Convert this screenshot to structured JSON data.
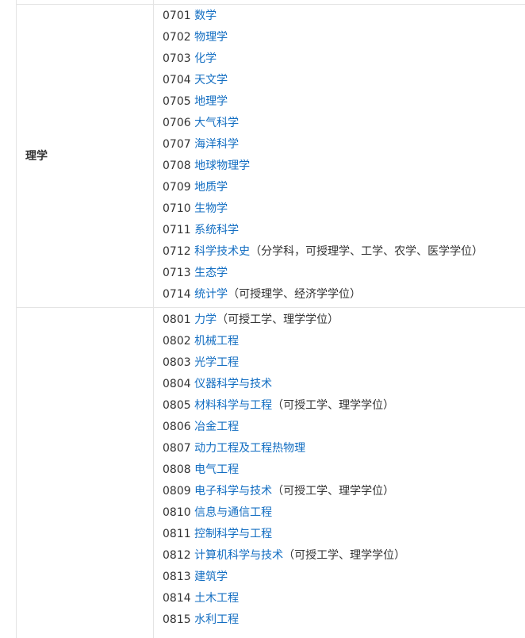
{
  "sections": [
    {
      "category": "理学",
      "items": [
        {
          "code": "0701",
          "name": "数学",
          "note": ""
        },
        {
          "code": "0702",
          "name": "物理学",
          "note": ""
        },
        {
          "code": "0703",
          "name": "化学",
          "note": ""
        },
        {
          "code": "0704",
          "name": "天文学",
          "note": ""
        },
        {
          "code": "0705",
          "name": "地理学",
          "note": ""
        },
        {
          "code": "0706",
          "name": "大气科学",
          "note": ""
        },
        {
          "code": "0707",
          "name": "海洋科学",
          "note": ""
        },
        {
          "code": "0708",
          "name": "地球物理学",
          "note": ""
        },
        {
          "code": "0709",
          "name": "地质学",
          "note": ""
        },
        {
          "code": "0710",
          "name": "生物学",
          "note": ""
        },
        {
          "code": "0711",
          "name": "系统科学",
          "note": ""
        },
        {
          "code": "0712",
          "name": "科学技术史",
          "note": "（分学科，可授理学、工学、农学、医学学位）"
        },
        {
          "code": "0713",
          "name": "生态学",
          "note": ""
        },
        {
          "code": "0714",
          "name": "统计学",
          "note": "（可授理学、经济学学位）"
        }
      ]
    },
    {
      "category": "",
      "items": [
        {
          "code": "0801",
          "name": "力学",
          "note": "（可授工学、理学学位）"
        },
        {
          "code": "0802",
          "name": "机械工程",
          "note": ""
        },
        {
          "code": "0803",
          "name": "光学工程",
          "note": ""
        },
        {
          "code": "0804",
          "name": "仪器科学与技术",
          "note": ""
        },
        {
          "code": "0805",
          "name": "材料科学与工程",
          "note": "（可授工学、理学学位）"
        },
        {
          "code": "0806",
          "name": "冶金工程",
          "note": ""
        },
        {
          "code": "0807",
          "name": "动力工程及工程热物理",
          "note": ""
        },
        {
          "code": "0808",
          "name": "电气工程",
          "note": ""
        },
        {
          "code": "0809",
          "name": "电子科学与技术",
          "note": "（可授工学、理学学位）"
        },
        {
          "code": "0810",
          "name": "信息与通信工程",
          "note": ""
        },
        {
          "code": "0811",
          "name": "控制科学与工程",
          "note": ""
        },
        {
          "code": "0812",
          "name": "计算机科学与技术",
          "note": "（可授工学、理学学位）"
        },
        {
          "code": "0813",
          "name": "建筑学",
          "note": ""
        },
        {
          "code": "0814",
          "name": "土木工程",
          "note": ""
        },
        {
          "code": "0815",
          "name": "水利工程",
          "note": ""
        }
      ]
    }
  ],
  "colors": {
    "link": "#136ec2",
    "text": "#333333",
    "border": "#e4e4e4"
  }
}
